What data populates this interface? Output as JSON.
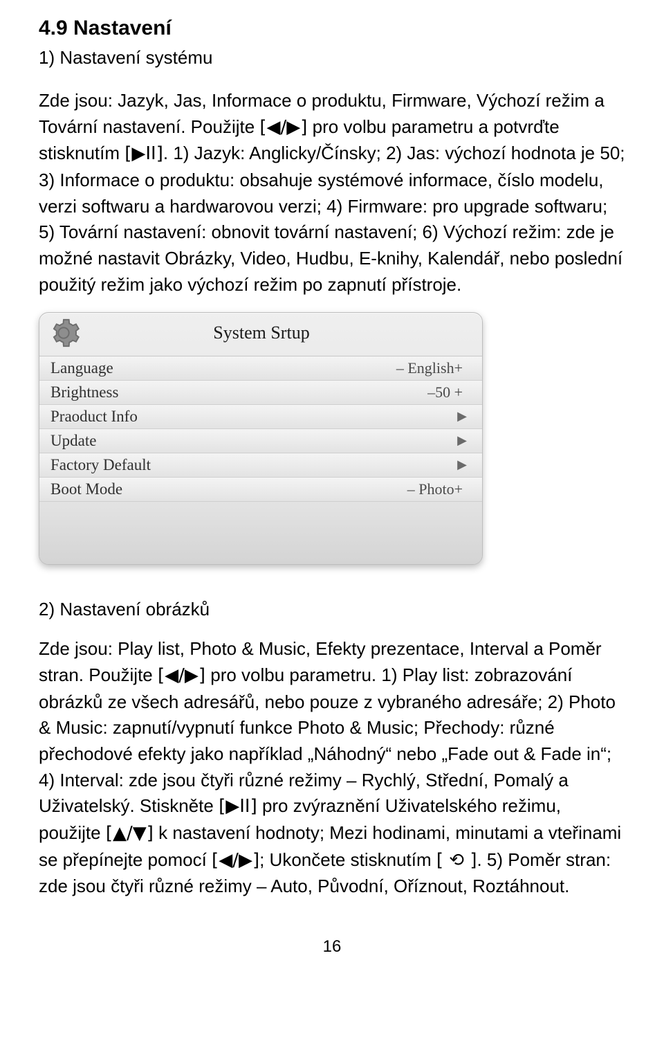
{
  "heading": "4.9 Nastavení",
  "section1_title": "1) Nastavení systému",
  "para1a": "Zde jsou: Jazyk, Jas, Informace o produktu, Firmware, Výchozí režim a Tovární nastavení. Použijte ",
  "icon_leftright": "[◀/▶]",
  "para1b": " pro volbu parametru a potvrďte stisknutím ",
  "icon_playpause": "[▶II]",
  "para1c": ". 1) Jazyk: Anglicky/Čínsky; 2) Jas: výchozí hodnota je 50; 3) Informace o produktu: obsahuje systémové informace, číslo modelu, verzi softwaru a hardwarovou verzi; 4) Firmware: pro upgrade softwaru; 5) Tovární nastavení: obnovit tovární nastavení; 6) Výchozí režim: zde je možné nastavit Obrázky, Video, Hudbu, E-knihy, Kalendář, nebo poslední použitý režim jako výchozí režim po zapnutí přístroje.",
  "panel": {
    "title": "System Srtup",
    "rows": [
      {
        "label": "Language",
        "value": "– English+",
        "caret": ""
      },
      {
        "label": "Brightness",
        "value": "–50 +",
        "caret": ""
      },
      {
        "label": "Praoduct Info",
        "value": "",
        "caret": "▶"
      },
      {
        "label": "Update",
        "value": "",
        "caret": "▶"
      },
      {
        "label": "Factory Default",
        "value": "",
        "caret": "▶"
      },
      {
        "label": "Boot Mode",
        "value": "– Photo+",
        "caret": ""
      }
    ]
  },
  "section2_title": "2) Nastavení obrázků",
  "p2_a": "Zde jsou: Play list, Photo & Music, Efekty prezentace, Interval a Poměr stran. Použijte ",
  "p2_b": " pro volbu parametru. 1) Play list: zobrazování obrázků ze všech adresářů, nebo pouze z vybraného adresáře; 2) Photo & Music: zapnutí/vypnutí funkce Photo & Music; Přechody: různé přechodové efekty jako například „Náhodný“ nebo „Fade out & Fade in“; 4) Interval: zde jsou čtyři různé režimy – Rychlý, Střední, Pomalý a Uživatelský. Stiskněte ",
  "p2_c": " pro zvýraznění Uživatelského režimu, použijte ",
  "icon_updown": "[▲/▼]",
  "p2_d": " k nastavení hodnoty; Mezi hodinami, minutami a vteřinami se přepínejte pomocí ",
  "p2_e": "; Ukončete stisknutím ",
  "icon_back": "[ ⟲ ]",
  "p2_f": ". 5) Poměr stran: zde jsou čtyři různé režimy – Auto, Původní, Oříznout, Roztáhnout.",
  "page_number": "16"
}
